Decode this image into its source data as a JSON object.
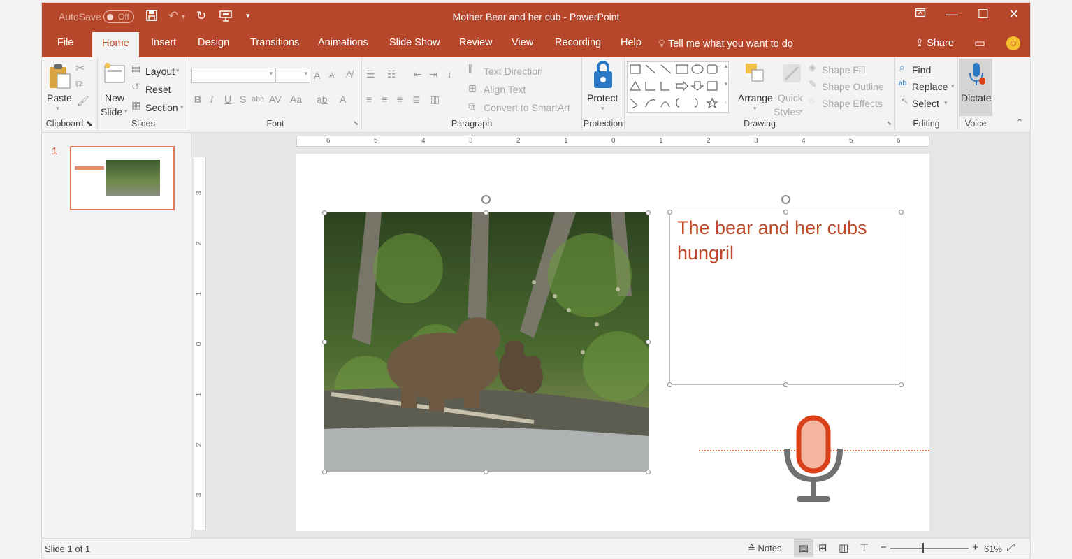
{
  "titlebar": {
    "autosave_label": "AutoSave",
    "autosave_state": "Off",
    "document_title": "Mother Bear and her cub - PowerPoint"
  },
  "tabs": [
    "File",
    "Home",
    "Insert",
    "Design",
    "Transitions",
    "Animations",
    "Slide Show",
    "Review",
    "View",
    "Recording",
    "Help"
  ],
  "tell_me": "Tell me what you want to do",
  "share_label": "Share",
  "ribbon": {
    "clipboard": {
      "paste": "Paste",
      "label": "Clipboard"
    },
    "slides": {
      "new_slide_1": "New",
      "new_slide_2": "Slide",
      "layout": "Layout",
      "reset": "Reset",
      "section": "Section",
      "label": "Slides"
    },
    "font": {
      "label": "Font",
      "grow": "A",
      "shrink": "A",
      "bold": "B",
      "italic": "I",
      "underline": "U",
      "shadow": "S",
      "strike": "abc",
      "spacing": "AV",
      "case": "Aa",
      "color": "A"
    },
    "paragraph": {
      "text_direction": "Text Direction",
      "align_text": "Align Text",
      "smartart": "Convert to SmartArt",
      "label": "Paragraph"
    },
    "protection": {
      "protect": "Protect",
      "label": "Protection"
    },
    "drawing": {
      "arrange": "Arrange",
      "quick_1": "Quick",
      "quick_2": "Styles",
      "shape_fill": "Shape Fill",
      "shape_outline": "Shape Outline",
      "shape_effects": "Shape Effects",
      "label": "Drawing"
    },
    "editing": {
      "find": "Find",
      "replace": "Replace",
      "select": "Select",
      "label": "Editing"
    },
    "voice": {
      "dictate": "Dictate",
      "label": "Voice"
    }
  },
  "thumbnail": {
    "number": "1"
  },
  "ruler": {
    "h_labels": [
      "6",
      "5",
      "4",
      "3",
      "2",
      "1",
      "0",
      "1",
      "2",
      "3",
      "4",
      "5",
      "6"
    ],
    "v_labels": [
      "3",
      "2",
      "1",
      "0",
      "1",
      "2",
      "3"
    ]
  },
  "slide": {
    "textbox_text": "The bear and her cubs hungril"
  },
  "status": {
    "slide_counter": "Slide 1 of 1",
    "notes": "Notes",
    "zoom": "61%",
    "zoom_level": 0.61
  },
  "colors": {
    "accent": "#b7472a",
    "text_accent": "#c0492a",
    "mic": "#d9411b"
  }
}
